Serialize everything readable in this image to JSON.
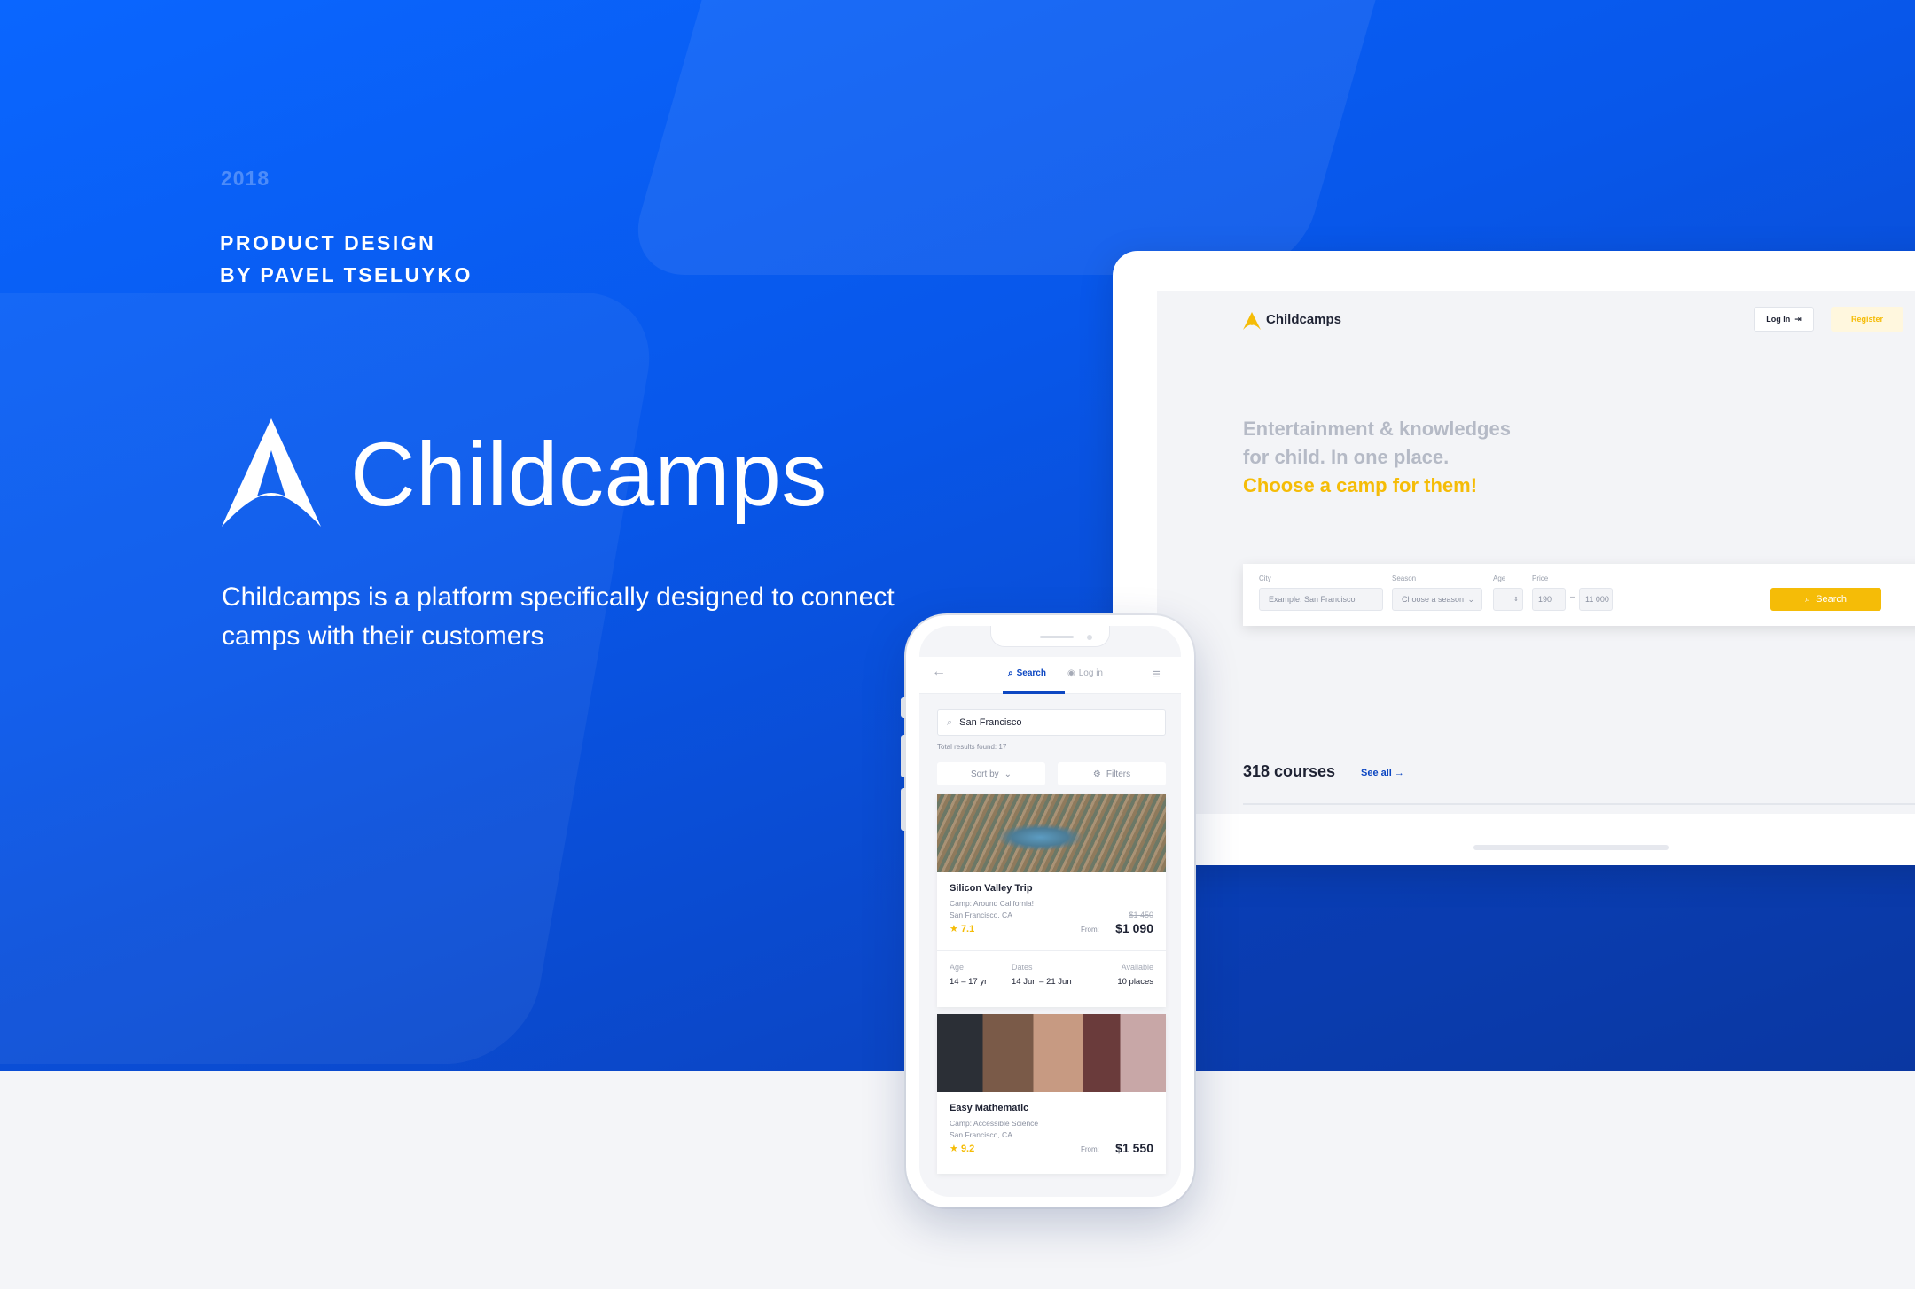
{
  "hero": {
    "year": "2018",
    "credit_line1": "PRODUCT DESIGN",
    "credit_line2": "BY PAVEL TSELUYKO",
    "brand": "Childcamps",
    "tagline": "Childcamps is a platform specifically designed to connect camps with their customers"
  },
  "colors": {
    "primary": "#0a5cf5",
    "accent": "#f5bc07",
    "dark_text": "#1e2233"
  },
  "desktop": {
    "brand": "Childcamps",
    "login_label": "Log In",
    "register_label": "Register",
    "headline1": "Entertainment & knowledges",
    "headline2": "for child. In one place.",
    "headline3": "Choose a camp for them!",
    "form": {
      "city_label": "City",
      "city_placeholder": "Example: San Francisco",
      "season_label": "Season",
      "season_value": "Choose a season",
      "age_label": "Age",
      "price_label": "Price",
      "price_min": "190",
      "price_max": "11 000",
      "search_label": "Search"
    },
    "courses_count": "318 courses",
    "see_all": "See all"
  },
  "mobile": {
    "tab_search": "Search",
    "tab_login": "Log in",
    "search_value": "San Francisco",
    "total": "Total results found: 17",
    "sort_label": "Sort by",
    "filter_label": "Filters",
    "cards": [
      {
        "title": "Silicon Valley Trip",
        "camp": "Camp: Around California!",
        "location": "San Francisco, CA",
        "rating": "7.1",
        "old_price": "$1 450",
        "from": "From:",
        "price": "$1 090",
        "age_label": "Age",
        "age": "14 – 17 yr",
        "dates_label": "Dates",
        "dates": "14 Jun – 21 Jun",
        "avail_label": "Available",
        "avail": "10 places"
      },
      {
        "title": "Easy Mathematic",
        "camp": "Camp: Accessible Science",
        "location": "San Francisco, CA",
        "rating": "9.2",
        "from": "From:",
        "price": "$1 550"
      }
    ]
  }
}
